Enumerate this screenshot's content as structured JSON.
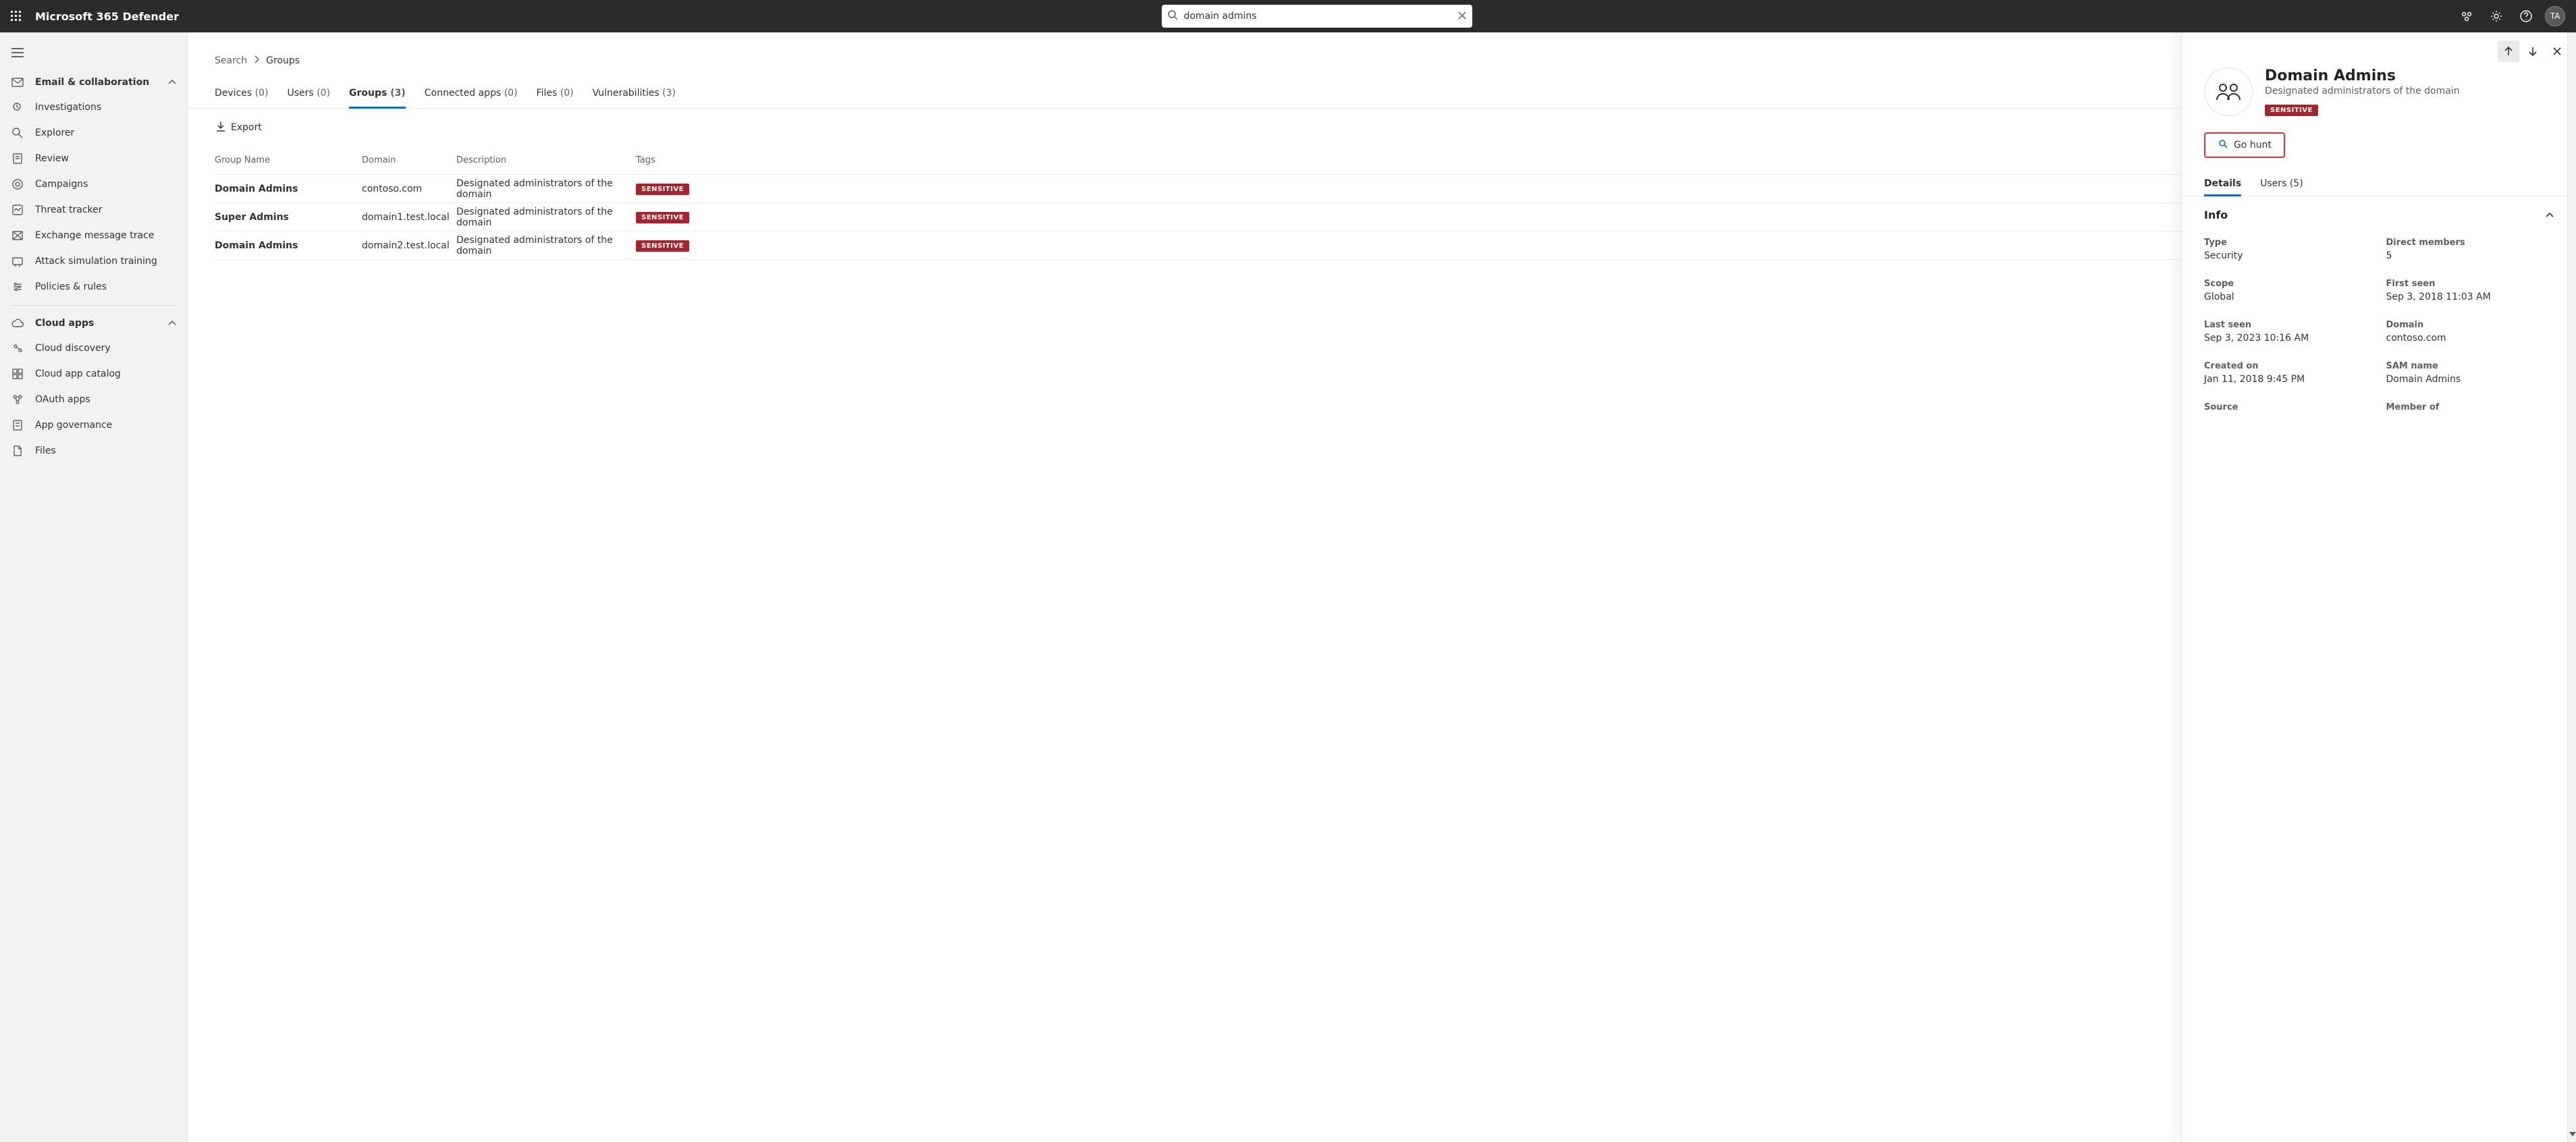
{
  "header": {
    "app_title": "Microsoft 365 Defender",
    "search_value": "domain admins",
    "avatar_initials": "TA"
  },
  "sidebar": {
    "section1": {
      "label": "Email & collaboration"
    },
    "items1": [
      {
        "label": "Investigations"
      },
      {
        "label": "Explorer"
      },
      {
        "label": "Review"
      },
      {
        "label": "Campaigns"
      },
      {
        "label": "Threat tracker"
      },
      {
        "label": "Exchange message trace"
      },
      {
        "label": "Attack simulation training"
      },
      {
        "label": "Policies & rules"
      }
    ],
    "section2": {
      "label": "Cloud apps"
    },
    "items2": [
      {
        "label": "Cloud discovery"
      },
      {
        "label": "Cloud app catalog"
      },
      {
        "label": "OAuth apps"
      },
      {
        "label": "App governance"
      },
      {
        "label": "Files"
      }
    ]
  },
  "breadcrumbs": {
    "root": "Search",
    "current": "Groups"
  },
  "tabs": [
    {
      "label": "Devices",
      "count": "(0)"
    },
    {
      "label": "Users",
      "count": "(0)"
    },
    {
      "label": "Groups",
      "count": "(3)"
    },
    {
      "label": "Connected apps",
      "count": "(0)"
    },
    {
      "label": "Files",
      "count": "(0)"
    },
    {
      "label": "Vulnerabilities",
      "count": "(3)"
    }
  ],
  "toolbar": {
    "export": "Export"
  },
  "table": {
    "headers": {
      "name": "Group Name",
      "domain": "Domain",
      "desc": "Description",
      "tags": "Tags"
    },
    "rows": [
      {
        "name": "Domain Admins",
        "domain": "contoso.com",
        "desc": "Designated administrators of the domain",
        "tag": "SENSITIVE"
      },
      {
        "name": "Super Admins",
        "domain": "domain1.test.local",
        "desc": "Designated administrators of the domain",
        "tag": "SENSITIVE"
      },
      {
        "name": "Domain Admins",
        "domain": "domain2.test.local",
        "desc": "Designated administrators of the domain",
        "tag": "SENSITIVE"
      }
    ]
  },
  "flyout": {
    "title": "Domain Admins",
    "subtitle": "Designated administrators of the domain",
    "tag": "SENSITIVE",
    "go_hunt": "Go hunt",
    "tabs": {
      "details": "Details",
      "users": "Users (5)"
    },
    "info_header": "Info",
    "info": {
      "type_label": "Type",
      "type_value": "Security",
      "members_label": "Direct members",
      "members_value": "5",
      "scope_label": "Scope",
      "scope_value": "Global",
      "first_seen_label": "First seen",
      "first_seen_value": "Sep 3, 2018 11:03 AM",
      "last_seen_label": "Last seen",
      "last_seen_value": "Sep 3, 2023 10:16 AM",
      "domain_label": "Domain",
      "domain_value": "contoso.com",
      "created_label": "Created on",
      "created_value": "Jan 11, 2018 9:45 PM",
      "sam_label": "SAM name",
      "sam_value": "Domain Admins",
      "source_label": "Source",
      "member_of_label": "Member of"
    }
  }
}
